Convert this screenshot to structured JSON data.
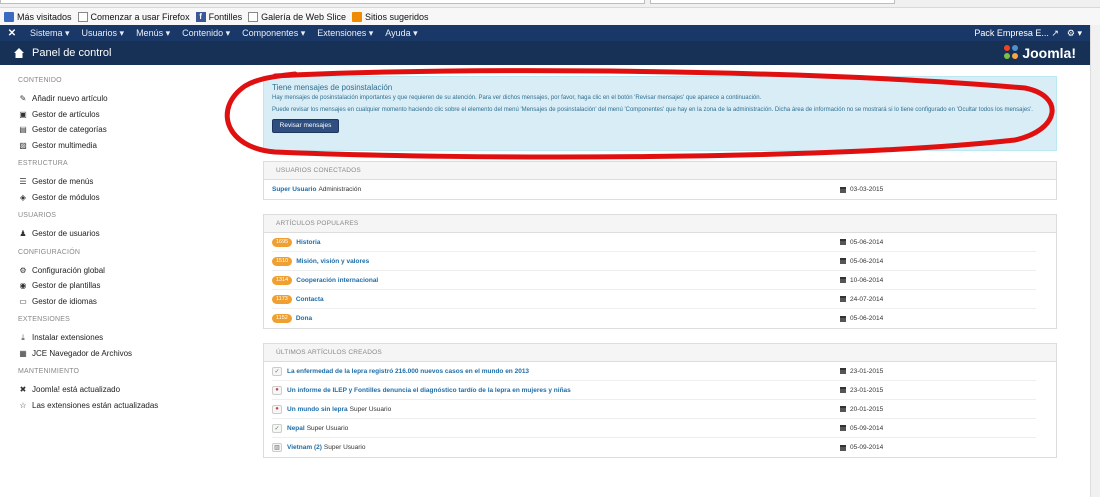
{
  "bookmarks": [
    {
      "label": "Más visitados",
      "icon": "bookmark-icon"
    },
    {
      "label": "Comenzar a usar Firefox",
      "icon": "page-icon"
    },
    {
      "label": "Fontilles",
      "icon": "facebook-icon"
    },
    {
      "label": "Galería de Web Slice",
      "icon": "page-icon"
    },
    {
      "label": "Sitios sugeridos",
      "icon": "suggested-icon"
    }
  ],
  "nav": {
    "logo": "✕",
    "items": [
      "Sistema ▾",
      "Usuarios ▾",
      "Menús ▾",
      "Contenido ▾",
      "Componentes ▾",
      "Extensiones ▾",
      "Ayuda ▾"
    ],
    "site_name": "Pack Empresa E... ↗",
    "gear": "⚙ ▾"
  },
  "header": {
    "title": "Panel de control",
    "brand": "Joomla!"
  },
  "sidebar": {
    "sections": [
      {
        "heading": "CONTENIDO",
        "items": [
          {
            "label": "Añadir nuevo artículo",
            "icon": "pencil-icon",
            "glyph": "✎"
          },
          {
            "label": "Gestor de artículos",
            "icon": "stack-icon",
            "glyph": "▣"
          },
          {
            "label": "Gestor de categorías",
            "icon": "folder-icon",
            "glyph": "▤"
          },
          {
            "label": "Gestor multimedia",
            "icon": "picture-icon",
            "glyph": "▨"
          }
        ]
      },
      {
        "heading": "ESTRUCTURA",
        "items": [
          {
            "label": "Gestor de menús",
            "icon": "list-icon",
            "glyph": "☰"
          },
          {
            "label": "Gestor de módulos",
            "icon": "cube-icon",
            "glyph": "◈"
          }
        ]
      },
      {
        "heading": "USUARIOS",
        "items": [
          {
            "label": "Gestor de usuarios",
            "icon": "users-icon",
            "glyph": "♟"
          }
        ]
      },
      {
        "heading": "CONFIGURACIÓN",
        "items": [
          {
            "label": "Configuración global",
            "icon": "cog-icon",
            "glyph": "⚙"
          },
          {
            "label": "Gestor de plantillas",
            "icon": "eye-icon",
            "glyph": "◉"
          },
          {
            "label": "Gestor de idiomas",
            "icon": "comments-icon",
            "glyph": "▭"
          }
        ]
      },
      {
        "heading": "EXTENSIONES",
        "items": [
          {
            "label": "Instalar extensiones",
            "icon": "upload-icon",
            "glyph": "⤓"
          },
          {
            "label": "JCE Navegador de Archivos",
            "icon": "file-browser-icon",
            "glyph": "▦"
          }
        ]
      },
      {
        "heading": "MANTENIMIENTO",
        "items": [
          {
            "label": "Joomla! está actualizado",
            "icon": "joomla-icon",
            "glyph": "✖"
          },
          {
            "label": "Las extensiones están actualizadas",
            "icon": "star-icon",
            "glyph": "☆"
          }
        ]
      }
    ]
  },
  "alert": {
    "title": "Tiene mensajes de posinstalación",
    "line1": "Hay mensajes de posinstalación importantes y que requieren de su atención. Para ver dichos mensajes, por favor, haga clic en el botón 'Revisar mensajes' que aparece a continuación.",
    "line2": "Puede revisar los mensajes en cualquier momento haciendo clic sobre el elemento del menú 'Mensajes de posinstalación' del menú 'Componentes' que hay en la zona de la administración. Dicha área de información no se mostrará si lo tiene configurado en 'Ocultar todos los mensajes'.",
    "button": "Revisar mensajes"
  },
  "logged_users": {
    "heading": "USUARIOS CONECTADOS",
    "rows": [
      {
        "name": "Super Usuario",
        "area": "Administración",
        "date": "03-03-2015"
      }
    ]
  },
  "popular": {
    "heading": "ARTÍCULOS POPULARES",
    "rows": [
      {
        "hits": "1695",
        "title": "Historia",
        "date": "05-06-2014"
      },
      {
        "hits": "1510",
        "title": "Misión, visión y valores",
        "date": "05-06-2014"
      },
      {
        "hits": "1314",
        "title": "Cooperación internacional",
        "date": "10-06-2014"
      },
      {
        "hits": "1173",
        "title": "Contacta",
        "date": "24-07-2014"
      },
      {
        "hits": "1152",
        "title": "Dona",
        "date": "05-06-2014"
      }
    ]
  },
  "latest": {
    "heading": "ÚLTIMOS ARTÍCULOS CREADOS",
    "rows": [
      {
        "status": "published",
        "glyph": "✓",
        "title": "La enfermedad de la lepra registró 216.000 nuevos casos en el mundo en 2013",
        "author": "",
        "date": "23-01-2015"
      },
      {
        "status": "unpublished",
        "glyph": "●",
        "title": "Un informe de ILEP y Fontilles denuncia el diagnóstico tardío de la lepra en mujeres y niñas",
        "author": "",
        "date": "23-01-2015"
      },
      {
        "status": "unpublished",
        "glyph": "●",
        "title": "Un mundo sin lepra",
        "author": "Super Usuario",
        "date": "20-01-2015"
      },
      {
        "status": "published",
        "glyph": "✓",
        "title": "Nepal",
        "author": "Super Usuario",
        "date": "05-09-2014"
      },
      {
        "status": "archived",
        "glyph": "▥",
        "title": "Vietnam (2)",
        "author": "Super Usuario",
        "date": "05-09-2014"
      }
    ]
  },
  "colors": {
    "navbar": "#1a3867",
    "subheader": "#163056",
    "link": "#1e6da8",
    "badge": "#f0a030",
    "alert_bg": "#d9edf7",
    "annotation": "#e01010"
  }
}
